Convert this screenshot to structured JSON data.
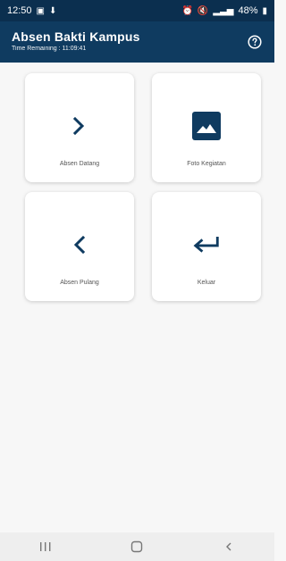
{
  "status_bar": {
    "time": "12:50",
    "left_icons": [
      "gallery-icon",
      "download-icon"
    ],
    "battery": "48%"
  },
  "header": {
    "title": "Absen Bakti Kampus",
    "subtitle": "Time Remaining : 11:09:41",
    "help_icon": "help-icon"
  },
  "cards": [
    {
      "label": "Absen Datang",
      "icon": "chevron-right-icon"
    },
    {
      "label": "Foto Kegiatan",
      "icon": "image-icon"
    },
    {
      "label": "Absen Pulang",
      "icon": "chevron-left-icon"
    },
    {
      "label": "Keluar",
      "icon": "keyboard-return-icon"
    }
  ],
  "navigation": {
    "recents": "recents-icon",
    "home": "home-icon",
    "back": "back-icon"
  },
  "colors": {
    "primary": "#0f3b60",
    "status": "#0b2f4f",
    "background": "#f7f7f7",
    "nav": "#eeeeee"
  }
}
